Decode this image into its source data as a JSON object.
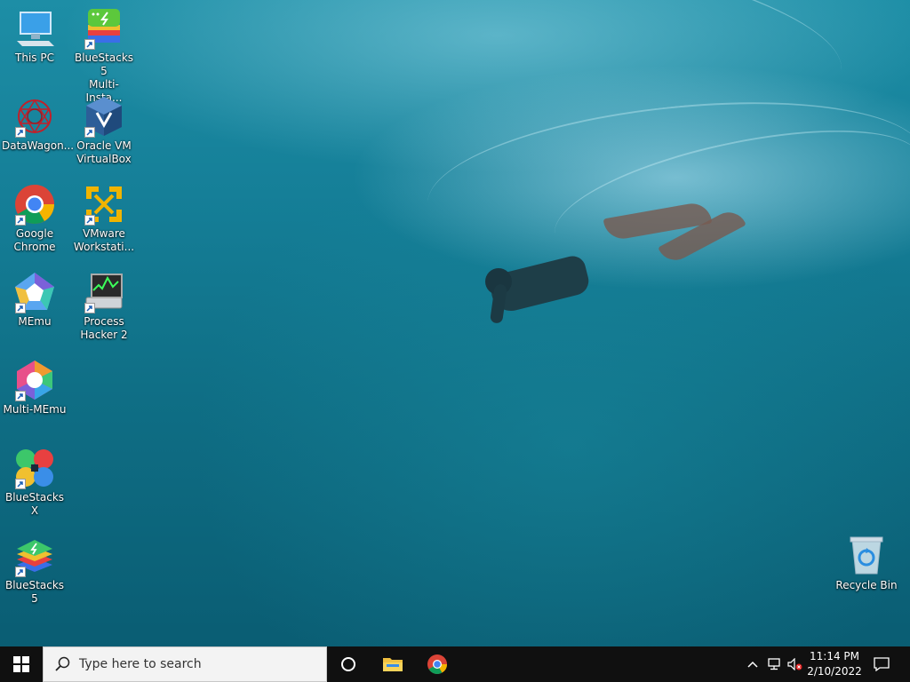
{
  "desktop": {
    "icons": [
      {
        "label": "This PC",
        "icon": "this-pc-icon",
        "shortcut": false
      },
      {
        "label": "BlueStacks 5\nMulti-Insta...",
        "icon": "bluestacks-multi-instance-icon",
        "shortcut": true
      },
      {
        "label": "DataWagon...",
        "icon": "datawagon-icon",
        "shortcut": true
      },
      {
        "label": "Oracle VM\nVirtualBox",
        "icon": "virtualbox-icon",
        "shortcut": true
      },
      {
        "label": "Google\nChrome",
        "icon": "chrome-icon",
        "shortcut": true
      },
      {
        "label": "VMware\nWorkstati...",
        "icon": "vmware-icon",
        "shortcut": true
      },
      {
        "label": "MEmu",
        "icon": "memu-icon",
        "shortcut": true
      },
      {
        "label": "Process\nHacker 2",
        "icon": "process-hacker-icon",
        "shortcut": true
      },
      {
        "label": "Multi-MEmu",
        "icon": "multi-memu-icon",
        "shortcut": true
      },
      {
        "label": "BlueStacks X",
        "icon": "bluestacks-x-icon",
        "shortcut": true
      },
      {
        "label": "BlueStacks 5",
        "icon": "bluestacks-5-icon",
        "shortcut": true
      },
      {
        "label": "Recycle Bin",
        "icon": "recycle-bin-icon",
        "shortcut": false
      }
    ]
  },
  "taskbar": {
    "start_icon": "windows-start-icon",
    "search_placeholder": "Type here to search",
    "search_icon": "search-icon",
    "cortana_icon": "cortana-circle-icon",
    "pinned": [
      {
        "name": "file-explorer",
        "icon": "folder-icon"
      },
      {
        "name": "google-chrome",
        "icon": "chrome-icon"
      }
    ],
    "tray": {
      "time": "11:14 PM",
      "date": "2/10/2022",
      "icons": [
        "chevron-up-icon",
        "network-icon",
        "volume-muted-icon",
        "notification-icon"
      ]
    }
  }
}
